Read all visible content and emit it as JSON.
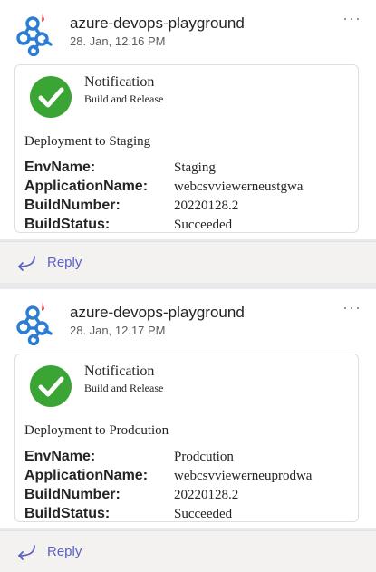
{
  "messages": [
    {
      "sender": "azure-devops-playground",
      "timestamp": "28. Jan, 12.16 PM",
      "more": "···",
      "card": {
        "title": "Notification",
        "subtitle": "Build and Release",
        "description": "Deployment to Staging",
        "facts": [
          {
            "key": "EnvName:",
            "value": "Staging"
          },
          {
            "key": "ApplicationName:",
            "value": "webcsvviewerneustgwa"
          },
          {
            "key": "BuildNumber:",
            "value": "20220128.2"
          },
          {
            "key": "BuildStatus:",
            "value": "Succeeded"
          }
        ]
      },
      "reply_label": "Reply"
    },
    {
      "sender": "azure-devops-playground",
      "timestamp": "28. Jan, 12.17 PM",
      "more": "···",
      "card": {
        "title": "Notification",
        "subtitle": "Build and Release",
        "description": "Deployment to Prodcution",
        "facts": [
          {
            "key": "EnvName:",
            "value": "Prodcution"
          },
          {
            "key": "ApplicationName:",
            "value": "webcsvviewerneuprodwa"
          },
          {
            "key": "BuildNumber:",
            "value": "20220128.2"
          },
          {
            "key": "BuildStatus:",
            "value": "Succeeded"
          }
        ]
      },
      "reply_label": "Reply"
    }
  ],
  "colors": {
    "accent": "#5b5fc7",
    "bot_avatar": "#2b7cd3",
    "success": "#3aa535",
    "background": "#e9e9ec"
  },
  "icons": {
    "avatar": "azure-devops-bot-icon",
    "check": "check-circle-icon",
    "reply": "reply-arrow-icon",
    "more": "more-options-icon"
  }
}
